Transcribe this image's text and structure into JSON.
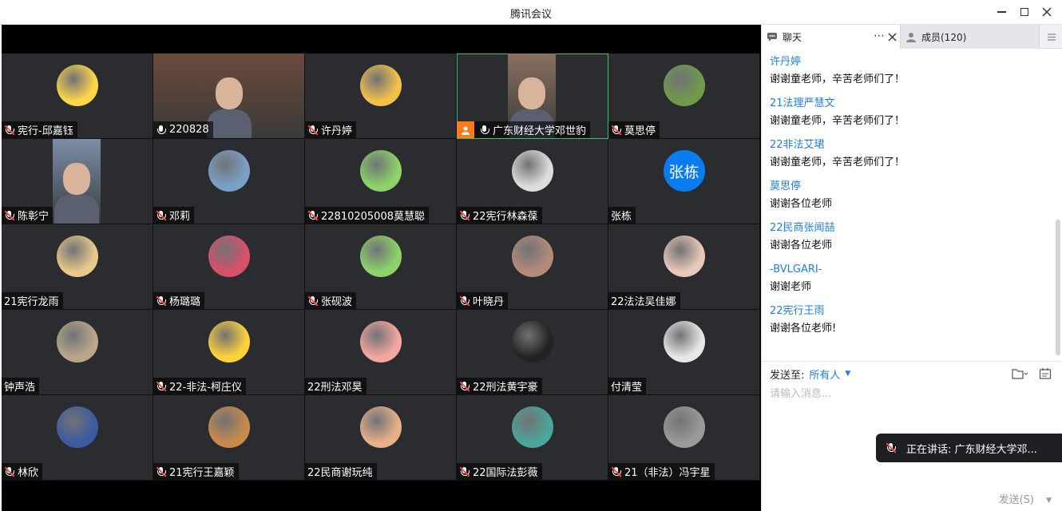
{
  "window": {
    "title": "腾讯会议"
  },
  "video_grid": [
    {
      "name": "宪行-邱嘉钰",
      "mic": "muted",
      "kind": "avatar",
      "bg": "#ffd54a"
    },
    {
      "name": "220828",
      "mic": "on",
      "kind": "camera",
      "bg": "#6b4a3a"
    },
    {
      "name": "许丹婷",
      "mic": "muted",
      "kind": "avatar",
      "bg": "#f2c14a"
    },
    {
      "name": "广东财经大学邓世豹",
      "mic": "on",
      "kind": "camera-host",
      "bg": "#8a7060"
    },
    {
      "name": "莫思停",
      "mic": "muted",
      "kind": "avatar",
      "bg": "#6f9a4a"
    },
    {
      "name": "陈彰宁",
      "mic": "muted",
      "kind": "camera",
      "bg": "#7b8fa8"
    },
    {
      "name": "邓莉",
      "mic": "muted",
      "kind": "avatar",
      "bg": "#7aa0c8"
    },
    {
      "name": "22810205008莫慧聪",
      "mic": "muted",
      "kind": "avatar",
      "bg": "#8cd36a"
    },
    {
      "name": "22宪行林森葆",
      "mic": "muted",
      "kind": "avatar",
      "bg": "#dddddd"
    },
    {
      "name": "张栋",
      "mic": "none",
      "kind": "text-avatar",
      "initials": "张栋",
      "bg": "#0a7cf0"
    },
    {
      "name": "21宪行龙雨",
      "mic": "none",
      "kind": "avatar",
      "bg": "#e7c98a"
    },
    {
      "name": "杨璐璐",
      "mic": "muted",
      "kind": "avatar",
      "bg": "#d9506a"
    },
    {
      "name": "张砚波",
      "mic": "muted",
      "kind": "avatar",
      "bg": "#8cd36a"
    },
    {
      "name": "叶晓丹",
      "mic": "muted",
      "kind": "avatar",
      "bg": "#b58a7a"
    },
    {
      "name": "22法法吴佳娜",
      "mic": "none",
      "kind": "avatar",
      "bg": "#e8c8b8"
    },
    {
      "name": "钟声浩",
      "mic": "none",
      "kind": "avatar",
      "bg": "#b9a68a"
    },
    {
      "name": "22-非法-柯庄仪",
      "mic": "muted",
      "kind": "avatar",
      "bg": "#ffd23a"
    },
    {
      "name": "22刑法邓昊",
      "mic": "none",
      "kind": "avatar",
      "bg": "#f4a6a0"
    },
    {
      "name": "22刑法黄宇豪",
      "mic": "muted",
      "kind": "avatar",
      "bg": "#222222"
    },
    {
      "name": "付清莹",
      "mic": "none",
      "kind": "avatar",
      "bg": "#e7e7e7"
    },
    {
      "name": "林欣",
      "mic": "muted",
      "kind": "avatar",
      "bg": "#3c5aa0"
    },
    {
      "name": "21宪行王嘉颖",
      "mic": "muted",
      "kind": "avatar",
      "bg": "#c98a4a"
    },
    {
      "name": "22民商谢玩纯",
      "mic": "none",
      "kind": "avatar",
      "bg": "#e7b08a"
    },
    {
      "name": "22国际法彭薇",
      "mic": "muted",
      "kind": "avatar",
      "bg": "#4aa59a"
    },
    {
      "name": "21（非法）冯宇星",
      "mic": "muted",
      "kind": "avatar",
      "bg": "#9a9a9a"
    }
  ],
  "sidebar": {
    "tab_chat": "聊天",
    "tab_chat_more": "⋯",
    "tab_members": "成员(120)",
    "messages": [
      {
        "sender": "许丹婷",
        "text": "谢谢童老师，辛苦老师们了！"
      },
      {
        "sender": "21法理严慧文",
        "text": "谢谢童老师，辛苦老师们了！"
      },
      {
        "sender": "22非法艾珺",
        "text": "谢谢童老师，辛苦老师们了！"
      },
      {
        "sender": "莫思停",
        "text": "谢谢各位老师"
      },
      {
        "sender": "22民商张闻喆",
        "text": "谢谢各位老师"
      },
      {
        "sender": "-BVLGARI-",
        "text": "谢谢老师"
      },
      {
        "sender": "22宪行王雨",
        "text": "谢谢各位老师!"
      }
    ],
    "composer": {
      "send_to_label": "发送至:",
      "send_to_target": "所有人",
      "placeholder": "请输入消息...",
      "send_label": "发送(S)"
    }
  },
  "speaking": {
    "text": "正在讲话: 广东财经大学邓..."
  },
  "colors": {
    "accent": "#1d7ee8",
    "host": "#ff7a1a",
    "active_border": "#3ec26c"
  }
}
